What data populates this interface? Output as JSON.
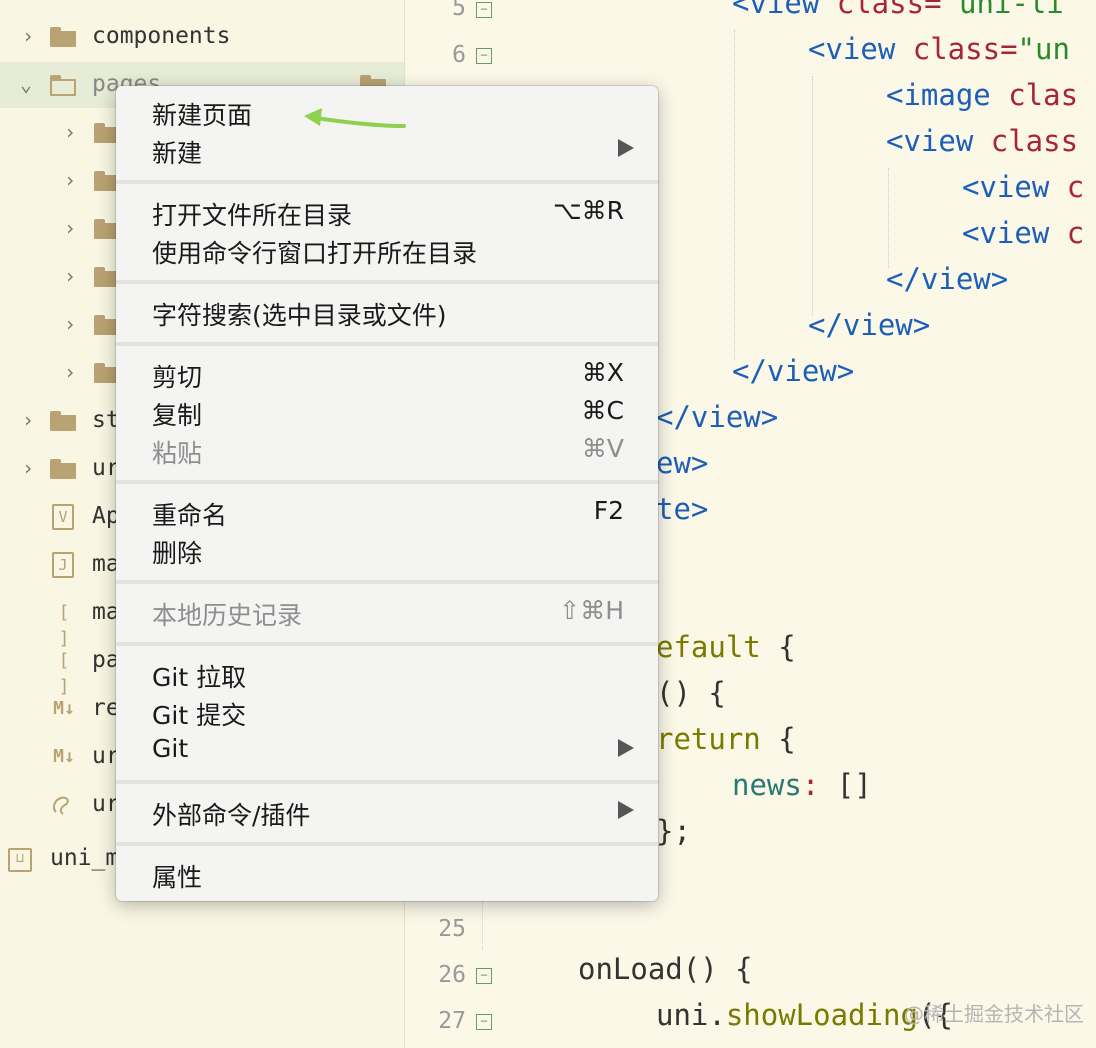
{
  "sidebar": {
    "items": [
      {
        "label": "components"
      },
      {
        "label": "pages"
      },
      {
        "label": ""
      },
      {
        "label": ""
      },
      {
        "label": ""
      },
      {
        "label": ""
      },
      {
        "label": ""
      },
      {
        "label": ""
      },
      {
        "label": "st"
      },
      {
        "label": "ur"
      },
      {
        "label": "Ap"
      },
      {
        "label": "ma"
      },
      {
        "label": "ma"
      },
      {
        "label": "pa"
      },
      {
        "label": "re"
      },
      {
        "label": "ur"
      },
      {
        "label": "ur"
      },
      {
        "label": "uni_m"
      }
    ],
    "icons": {
      "vue": "V",
      "json": "J",
      "brackets": "[ ]",
      "markdown": "M↓"
    }
  },
  "editor": {
    "line_numbers": [
      "5",
      "6",
      "25",
      "26",
      "27"
    ],
    "lines": [
      {
        "parts": [
          {
            "t": "<view ",
            "c": "tag"
          },
          {
            "t": "class=",
            "c": "attr"
          },
          {
            "t": "\"uni-li",
            "c": "str"
          }
        ]
      },
      {
        "parts": [
          {
            "t": "<view ",
            "c": "tag"
          },
          {
            "t": "class=",
            "c": "attr"
          },
          {
            "t": "\"un",
            "c": "str"
          }
        ]
      },
      {
        "parts": [
          {
            "t": "<image ",
            "c": "tag"
          },
          {
            "t": "clas",
            "c": "attr"
          }
        ]
      },
      {
        "parts": [
          {
            "t": "<view ",
            "c": "tag"
          },
          {
            "t": "class",
            "c": "attr"
          }
        ]
      },
      {
        "parts": [
          {
            "t": "<view ",
            "c": "tag"
          },
          {
            "t": "c",
            "c": "attr"
          }
        ]
      },
      {
        "parts": [
          {
            "t": "<view ",
            "c": "tag"
          },
          {
            "t": "c",
            "c": "attr"
          }
        ]
      },
      {
        "parts": [
          {
            "t": "</view>",
            "c": "tag"
          }
        ]
      },
      {
        "parts": [
          {
            "t": "</view>",
            "c": "tag"
          }
        ]
      },
      {
        "parts": [
          {
            "t": "</view>",
            "c": "tag"
          }
        ]
      },
      {
        "parts": [
          {
            "t": "</view>",
            "c": "tag"
          }
        ]
      },
      {
        "parts": [
          {
            "t": "ew>",
            "c": "tag"
          }
        ]
      },
      {
        "parts": [
          {
            "t": "te>",
            "c": "tag"
          }
        ]
      },
      {
        "parts": [
          {
            "t": "efault ",
            "c": "kw"
          },
          {
            "t": "{",
            "c": "plain"
          }
        ]
      },
      {
        "parts": [
          {
            "t": "() {",
            "c": "plain"
          }
        ]
      },
      {
        "parts": [
          {
            "t": "return ",
            "c": "kw"
          },
          {
            "t": "{",
            "c": "plain"
          }
        ]
      },
      {
        "parts": [
          {
            "t": "news",
            "c": "prop"
          },
          {
            "t": ": ",
            "c": "attr"
          },
          {
            "t": "[]",
            "c": "plain"
          }
        ]
      },
      {
        "parts": [
          {
            "t": "};",
            "c": "plain"
          }
        ]
      },
      {
        "parts": [
          {
            "t": "onLoad() {",
            "c": "plain"
          }
        ]
      },
      {
        "parts": [
          {
            "t": "uni.",
            "c": "plain"
          },
          {
            "t": "showLoading",
            "c": "fn"
          },
          {
            "t": "({",
            "c": "plain"
          }
        ]
      }
    ]
  },
  "menu": {
    "items": [
      {
        "label": "新建页面",
        "shortcut": "",
        "submenu": false,
        "disabled": false
      },
      {
        "label": "新建",
        "shortcut": "",
        "submenu": true,
        "disabled": false
      },
      {
        "label": "打开文件所在目录",
        "shortcut": "⌥⌘R",
        "submenu": false,
        "disabled": false
      },
      {
        "label": "使用命令行窗口打开所在目录",
        "shortcut": "",
        "submenu": false,
        "disabled": false
      },
      {
        "label": "字符搜索(选中目录或文件)",
        "shortcut": "",
        "submenu": false,
        "disabled": false
      },
      {
        "label": "剪切",
        "shortcut": "⌘X",
        "submenu": false,
        "disabled": false
      },
      {
        "label": "复制",
        "shortcut": "⌘C",
        "submenu": false,
        "disabled": false
      },
      {
        "label": "粘贴",
        "shortcut": "⌘V",
        "submenu": false,
        "disabled": true
      },
      {
        "label": "重命名",
        "shortcut": "F2",
        "submenu": false,
        "disabled": false
      },
      {
        "label": "删除",
        "shortcut": "",
        "submenu": false,
        "disabled": false
      },
      {
        "label": "本地历史记录",
        "shortcut": "⇧⌘H",
        "submenu": false,
        "disabled": true
      },
      {
        "label": "Git 拉取",
        "shortcut": "",
        "submenu": false,
        "disabled": false
      },
      {
        "label": "Git 提交",
        "shortcut": "",
        "submenu": false,
        "disabled": false
      },
      {
        "label": "Git",
        "shortcut": "",
        "submenu": true,
        "disabled": false
      },
      {
        "label": "外部命令/插件",
        "shortcut": "",
        "submenu": true,
        "disabled": false
      },
      {
        "label": "属性",
        "shortcut": "",
        "submenu": false,
        "disabled": false
      }
    ]
  },
  "annotation": {
    "arrow_color": "#8fd14f"
  },
  "watermark": "@稀土掘金技术社区",
  "colors": {
    "background": "#fbf8e8",
    "tag": "#1d5fb8",
    "attr": "#a8233d",
    "string": "#2a8b2a"
  }
}
